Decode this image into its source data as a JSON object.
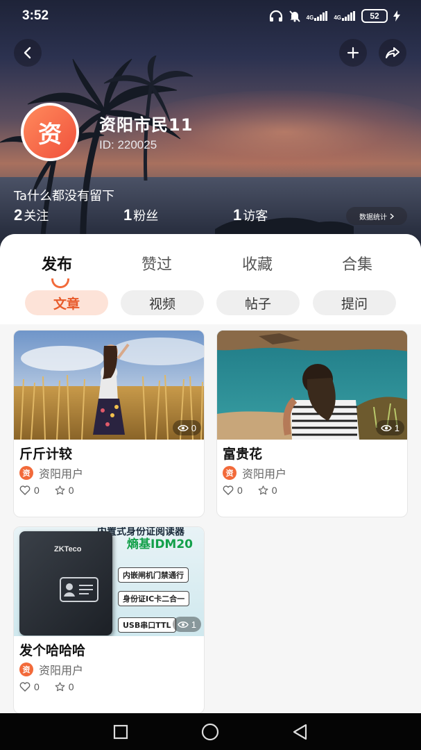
{
  "status_bar": {
    "time": "3:52",
    "network_1": "4G",
    "network_2": "4G",
    "battery": "52"
  },
  "profile": {
    "avatar_char": "资",
    "name": "资阳市民11",
    "id_text": "ID: 220025",
    "bio": "Ta什么都没有留下",
    "stats": [
      {
        "num": "2",
        "label": "关注"
      },
      {
        "num": "1",
        "label": "粉丝"
      },
      {
        "num": "1",
        "label": "访客"
      }
    ],
    "data_stats_label": "数据统计"
  },
  "tabs": [
    {
      "label": "发布",
      "active": true
    },
    {
      "label": "赞过",
      "active": false
    },
    {
      "label": "收藏",
      "active": false
    },
    {
      "label": "合集",
      "active": false
    }
  ],
  "chips": [
    {
      "label": "文章",
      "active": true
    },
    {
      "label": "视频",
      "active": false
    },
    {
      "label": "帖子",
      "active": false
    },
    {
      "label": "提问",
      "active": false
    }
  ],
  "cards": [
    {
      "title": "斤斤计较",
      "author": "资阳用户",
      "avatar_char": "资",
      "views": "0",
      "likes": "0",
      "stars": "0",
      "image": "woman-in-wheat-field"
    },
    {
      "title": "富贵花",
      "author": "资阳用户",
      "avatar_char": "资",
      "views": "1",
      "likes": "0",
      "stars": "0",
      "image": "woman-by-sea"
    },
    {
      "title": "发个哈哈哈",
      "author": "资阳用户",
      "avatar_char": "资",
      "views": "1",
      "likes": "0",
      "stars": "0",
      "image": "id-card-reader-ad"
    }
  ],
  "product_ad": {
    "headline": "内置式身份证阅读器",
    "model": "熵基IDM20",
    "brand": "ZKTeco",
    "features": [
      "内嵌闸机门禁通行",
      "身份证IC卡二合一",
      "USB串口TTL"
    ]
  },
  "colors": {
    "accent": "#f26a3a",
    "chip_active_bg": "#fde3d8"
  }
}
